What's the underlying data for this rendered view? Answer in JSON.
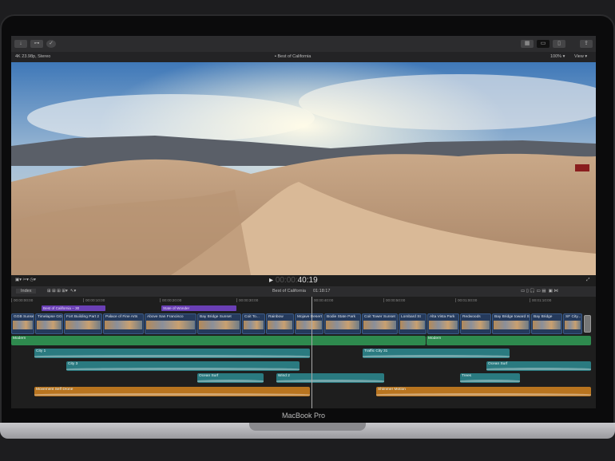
{
  "device": {
    "label": "MacBook Pro"
  },
  "toolbar": {
    "left_icons": [
      "import-icon",
      "keyword-icon",
      "background-tasks-icon"
    ],
    "right_icons": [
      "browser-layout-icon",
      "timeline-layout-icon",
      "inspector-layout-icon",
      "share-icon"
    ]
  },
  "viewer": {
    "format": "4K 23.98p, Stereo",
    "title": "Best of California",
    "zoom": "100%",
    "view": "View",
    "timecode": "40:19",
    "timecode_dim": "00:00:"
  },
  "timeline": {
    "index_label": "Index",
    "project": "Best of California",
    "duration": "01:18:17",
    "ruler": [
      "00:00:00:00",
      "00:00:10:00",
      "00:00:20:00",
      "00:00:30:00",
      "00:00:40:00",
      "00:00:50:00",
      "00:01:00:00",
      "00:01:10:00"
    ],
    "titles": [
      "Best of California – 30",
      "State of Wonder"
    ],
    "clips": [
      "GGB Sunset",
      "Timelapse GGB",
      "Fort Building Part 2",
      "Palace of Fine Arts",
      "Above San Francisco",
      "Bay Bridge Sunset",
      "Coit To...",
      "Rainbow",
      "Mojave Desert",
      "Bodie State Park",
      "Coit Tower Sunset",
      "Lombard St",
      "Alta Vista Park",
      "Redwoods",
      "Bay Bridge toward SF",
      "Bay Bridge",
      "SF City..."
    ],
    "music": [
      "Modern",
      "Modern"
    ],
    "audio": [
      "City 1",
      "Traffic City 31",
      "City 3",
      "Ocean Surf",
      "Ocean Surf",
      "Wind 2",
      "Trees",
      "Movement Self Drone",
      "Shimmer Motion"
    ]
  },
  "colors": {
    "video_clip": "#253a5c",
    "music": "#2e8a4e",
    "audio": "#2a7a80",
    "orange": "#b8741f",
    "title": "#6a3fb5"
  }
}
